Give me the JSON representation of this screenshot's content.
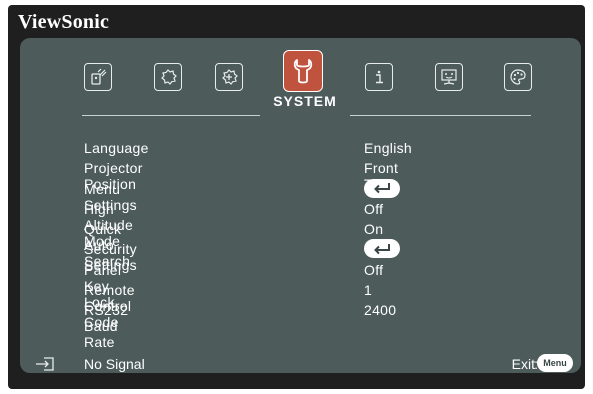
{
  "brand": "ViewSonic",
  "tabs": [
    {
      "id": "display",
      "icon": "display-icon",
      "active": false
    },
    {
      "id": "image-settings",
      "icon": "image-settings-icon",
      "active": false
    },
    {
      "id": "power-management",
      "icon": "power-management-icon",
      "active": false
    },
    {
      "id": "system",
      "icon": "wrench-icon",
      "active": true
    },
    {
      "id": "information",
      "icon": "information-icon",
      "active": false
    },
    {
      "id": "advanced",
      "icon": "advanced-screen-icon",
      "active": false
    },
    {
      "id": "basic",
      "icon": "palette-icon",
      "active": false
    }
  ],
  "active_tab_label": "SYSTEM",
  "menu_items": [
    {
      "label": "Language",
      "value": "English"
    },
    {
      "label": "Projector Position",
      "value": "Front Table"
    },
    {
      "label": "Menu Settings",
      "value": null,
      "enter": true
    },
    {
      "label": "High Altitude Mode",
      "value": "Off"
    },
    {
      "label": "Quick Auto Search",
      "value": "On"
    },
    {
      "label": "Security Settings",
      "value": null,
      "enter": true
    },
    {
      "label": "Panel Key Lock",
      "value": "Off"
    },
    {
      "label": "Remote Control Code",
      "value": "1"
    },
    {
      "label": "RS232 Baud Rate",
      "value": "2400"
    }
  ],
  "footer": {
    "input_icon": "input-source-icon",
    "status": "No Signal",
    "exit_label": "Exit",
    "menu_button_label": "Menu"
  },
  "colors": {
    "panel": "#4d5b5b",
    "active_tab": "#c0533e",
    "frame": "#1f1f1f"
  }
}
